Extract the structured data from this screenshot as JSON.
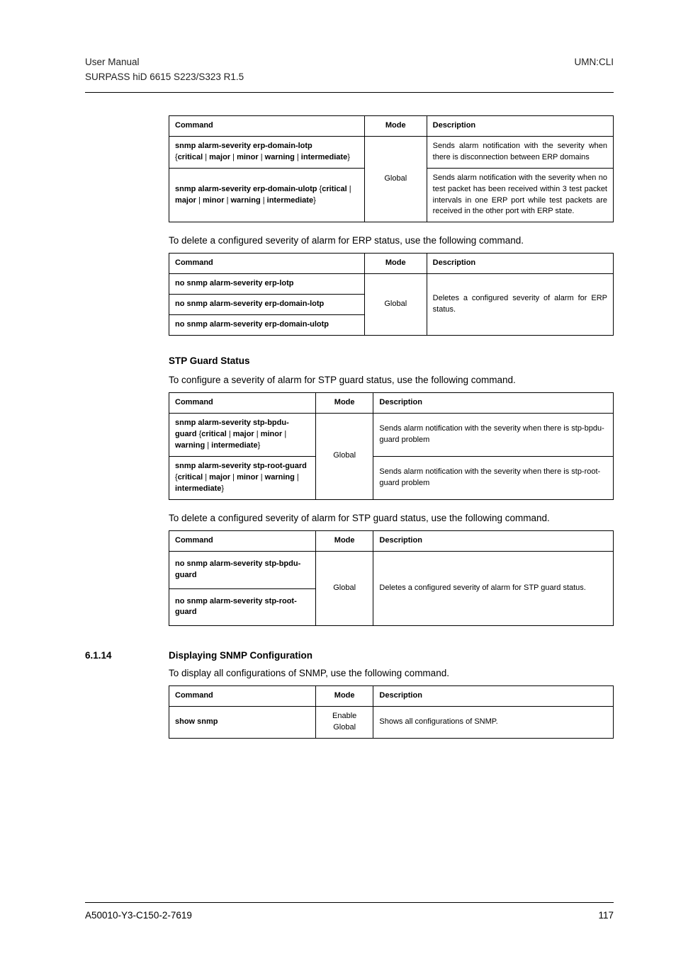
{
  "header": {
    "left_line1": "User  Manual",
    "left_line2": "SURPASS hiD 6615 S223/S323 R1.5",
    "right": "UMN:CLI"
  },
  "table1": {
    "h_cmd": "Command",
    "h_mode": "Mode",
    "h_desc": "Description",
    "mode": "Global",
    "r1_cmd_p1": "snmp alarm-severity erp-domain-lotp",
    "r1_cmd_p2": "{",
    "r1_cmd_p3": "critical",
    "r1_cmd_p4": " | ",
    "r1_cmd_p5": "major",
    "r1_cmd_p6": " | ",
    "r1_cmd_p7": "minor",
    "r1_cmd_p8": " | ",
    "r1_cmd_p9": "warning",
    "r1_cmd_p10": " | ",
    "r1_cmd_p11": "intermediate",
    "r1_cmd_p12": "}",
    "r1_desc": "Sends alarm notification with the severity when there is disconnection between ERP domains",
    "r2_cmd_p1": "snmp alarm-severity erp-domain-ulotp",
    "r2_cmd_p2": " {",
    "r2_cmd_p3": "critical",
    "r2_cmd_p4": " | ",
    "r2_cmd_p5": "major",
    "r2_cmd_p6": " | ",
    "r2_cmd_p7": "minor",
    "r2_cmd_p8": " | ",
    "r2_cmd_p9": "warning",
    "r2_cmd_p10": " | ",
    "r2_cmd_p11": "intermediate",
    "r2_cmd_p12": "}",
    "r2_desc": "Sends alarm notification with the severity when no test packet has been received within 3 test packet intervals in one ERP port while test packets are received in the other port with ERP state."
  },
  "para1": "To delete a configured severity of alarm for ERP status, use the following command.",
  "table2": {
    "h_cmd": "Command",
    "h_mode": "Mode",
    "h_desc": "Description",
    "mode": "Global",
    "r1": "no snmp alarm-severity erp-lotp",
    "r2": "no snmp alarm-severity erp-domain-lotp",
    "r3": "no snmp alarm-severity erp-domain-ulotp",
    "desc": "Deletes a configured severity of alarm for ERP status."
  },
  "section1": {
    "title": "STP Guard Status"
  },
  "para2": "To configure a severity of alarm for STP guard status, use the following command.",
  "table3": {
    "h_cmd": "Command",
    "h_mode": "Mode",
    "h_desc": "Description",
    "mode": "Global",
    "r1_p1": "snmp alarm-severity stp-bpdu-guard",
    "r1_p2": " {",
    "r1_p3": "critical",
    "r1_p4": " | ",
    "r1_p5": "major",
    "r1_p6": " | ",
    "r1_p7": "minor",
    "r1_p8": " | ",
    "r1_p9": "warning",
    "r1_p10": " | ",
    "r1_p11": "intermediate",
    "r1_p12": "}",
    "r1_desc": "Sends alarm notification with the severity when there is stp-bpdu-guard problem",
    "r2_p1": "snmp alarm-severity stp-root-guard",
    "r2_p2": " {",
    "r2_p3": "critical",
    "r2_p4": " | ",
    "r2_p5": "major",
    "r2_p6": " | ",
    "r2_p7": "minor",
    "r2_p8": " | ",
    "r2_p9": "warning",
    "r2_p10": " | ",
    "r2_p11": "intermediate",
    "r2_p12": "}",
    "r2_desc": "Sends alarm notification with the severity when there is stp-root-guard problem"
  },
  "para3": "To delete a configured severity of alarm for STP guard status, use the following command.",
  "table4": {
    "h_cmd": "Command",
    "h_mode": "Mode",
    "h_desc": "Description",
    "mode": "Global",
    "r1": "no snmp alarm-severity stp-bpdu-guard",
    "r2": "no snmp alarm-severity stp-root-guard",
    "desc": "Deletes a configured severity of alarm for STP guard status."
  },
  "section2": {
    "num": "6.1.14",
    "title": "Displaying SNMP Configuration"
  },
  "para4": "To display all configurations of SNMP, use the following command.",
  "table5": {
    "h_cmd": "Command",
    "h_mode": "Mode",
    "h_desc": "Description",
    "cmd": "show snmp",
    "mode1": "Enable",
    "mode2": "Global",
    "desc": "Shows all configurations of SNMP."
  },
  "footer": {
    "left": "A50010-Y3-C150-2-7619",
    "right": "117"
  }
}
